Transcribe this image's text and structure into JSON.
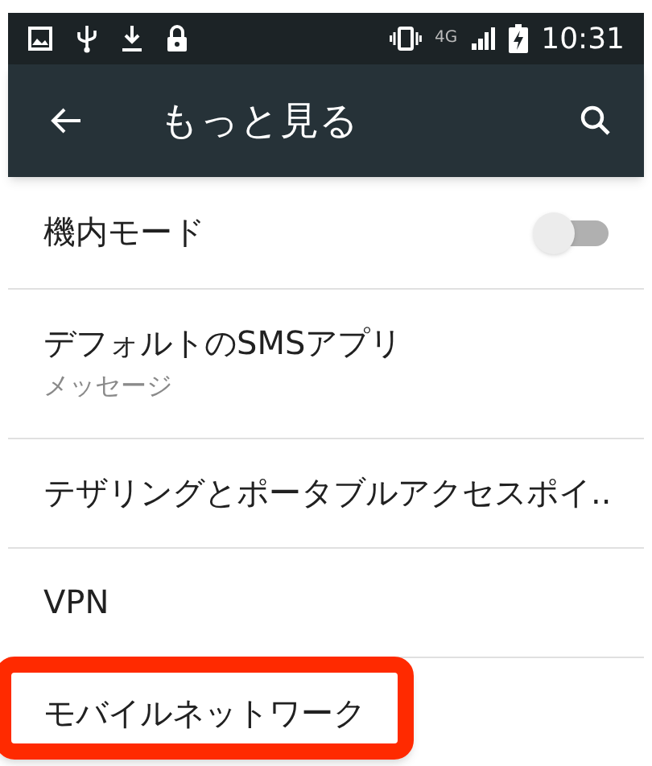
{
  "status_bar": {
    "network_type": "4G",
    "time": "10:31"
  },
  "app_bar": {
    "title": "もっと見る"
  },
  "items": [
    {
      "kind": "toggle",
      "title": "機内モード",
      "on": false,
      "highlighted": false
    },
    {
      "kind": "subtitle",
      "title": "デフォルトのSMSアプリ",
      "subtitle": "メッセージ",
      "highlighted": false
    },
    {
      "kind": "plain",
      "title": "テザリングとポータブルアクセスポイ..",
      "highlighted": false
    },
    {
      "kind": "plain",
      "title": "VPN",
      "highlighted": false
    },
    {
      "kind": "plain",
      "title": "モバイルネットワーク",
      "highlighted": true
    }
  ]
}
